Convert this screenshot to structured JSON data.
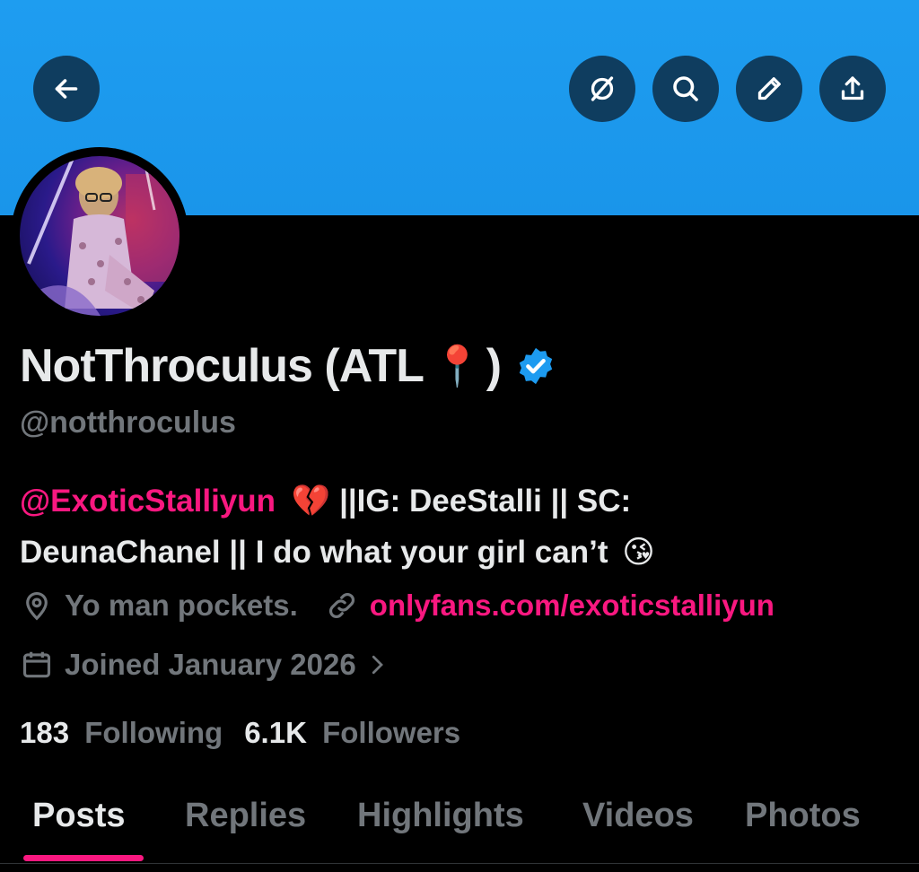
{
  "header": {
    "back_icon": "arrow-left-icon",
    "actions": [
      "grok-icon",
      "search-icon",
      "edit-icon",
      "share-icon"
    ]
  },
  "profile": {
    "display_name": "NotThroculus (ATL",
    "pin_emoji": "📍",
    "name_close": ")",
    "verified": true,
    "handle": "@notthroculus",
    "bio": {
      "mention": "@ExoticStalliyun",
      "heart_emoji": "💔",
      "line1_rest": "||IG: DeeStalli || SC:",
      "line2": "DeunaChanel || I do what your girl can’t",
      "kiss_emoji": "😘"
    },
    "location": "Yo man pockets.",
    "website": "onlyfans.com/exoticstalliyun",
    "joined": "Joined January 2026",
    "following_count": "183",
    "following_label": "Following",
    "followers_count": "6.1K",
    "followers_label": "Followers"
  },
  "tabs": [
    "Posts",
    "Replies",
    "Highlights",
    "Videos",
    "Photos"
  ],
  "colors": {
    "banner": "#1d9bf0",
    "accent": "#f91880",
    "muted": "#71767b",
    "verified": "#1d9bf0"
  }
}
